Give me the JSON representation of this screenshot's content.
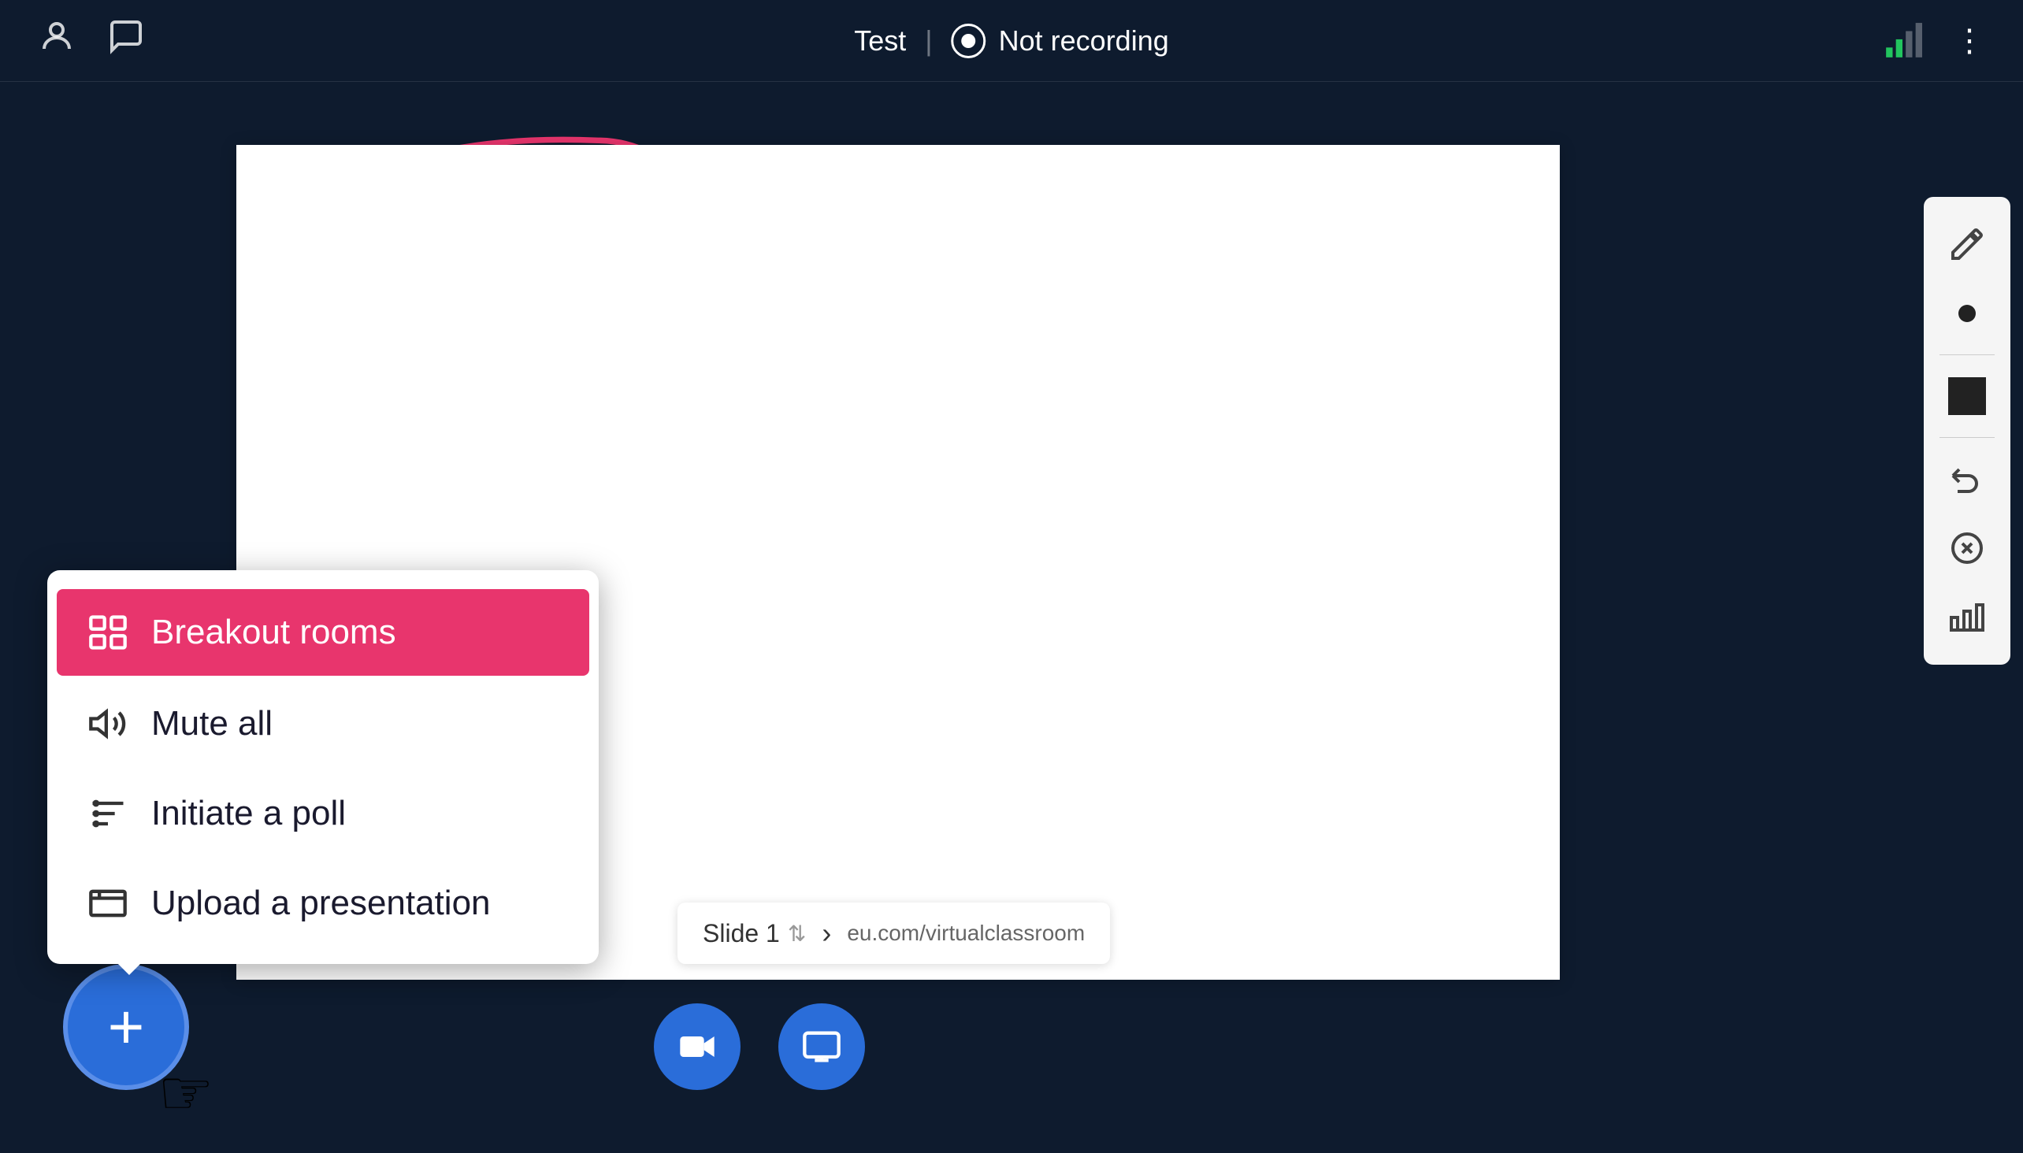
{
  "header": {
    "title": "Test",
    "divider": "|",
    "recording_label": "Not recording",
    "user_icon": "👤",
    "chat_icon": "💬"
  },
  "slide": {
    "current": "Slide 1",
    "url": "eu.com/virtualclassroom",
    "nav_arrow": "›"
  },
  "popup": {
    "items": [
      {
        "id": "breakout",
        "label": "Breakout rooms",
        "active": true
      },
      {
        "id": "mute",
        "label": "Mute all",
        "active": false
      },
      {
        "id": "poll",
        "label": "Initiate a poll",
        "active": false
      },
      {
        "id": "upload",
        "label": "Upload a presentation",
        "active": false
      }
    ]
  },
  "toolbar": {
    "undo_label": "Undo",
    "clear_label": "Clear",
    "chart_label": "Chart"
  },
  "fab": {
    "label": "+"
  }
}
